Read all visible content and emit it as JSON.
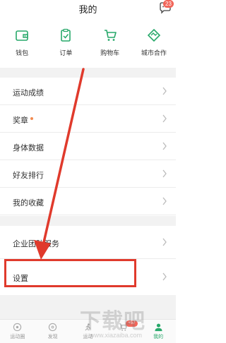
{
  "header": {
    "title": "我的",
    "message_badge": "23",
    "message_icon": "chat-bubble-icon"
  },
  "quick_actions": [
    {
      "label": "钱包",
      "icon": "wallet-icon"
    },
    {
      "label": "订单",
      "icon": "order-clipboard-icon"
    },
    {
      "label": "购物车",
      "icon": "shopping-cart-icon"
    },
    {
      "label": "城市合作",
      "icon": "handshake-diamond-icon"
    }
  ],
  "menu": {
    "items": [
      {
        "label": "运动成绩"
      },
      {
        "label": "奖章",
        "has_dot": true
      },
      {
        "label": "身体数据"
      },
      {
        "label": "好友排行"
      },
      {
        "label": "我的收藏"
      }
    ],
    "items2": [
      {
        "label": "企业团队服务"
      },
      {
        "label": "设置"
      }
    ]
  },
  "tabbar": {
    "tabs": [
      {
        "label": "运动圈",
        "icon": "circle-target-icon"
      },
      {
        "label": "发现",
        "icon": "compass-icon"
      },
      {
        "label": "运动",
        "icon": "run-icon"
      },
      {
        "label": "",
        "icon": "cart-icon",
        "badge": "+57"
      },
      {
        "label": "我的",
        "icon": "person-icon",
        "active": true
      }
    ]
  },
  "colors": {
    "accent": "#27a86a",
    "badge": "#f2665a",
    "annotation": "#e03a2c",
    "dot": "#f28a50"
  },
  "watermark": {
    "text": "下载吧",
    "sub": "www.xiazaiba.com"
  }
}
